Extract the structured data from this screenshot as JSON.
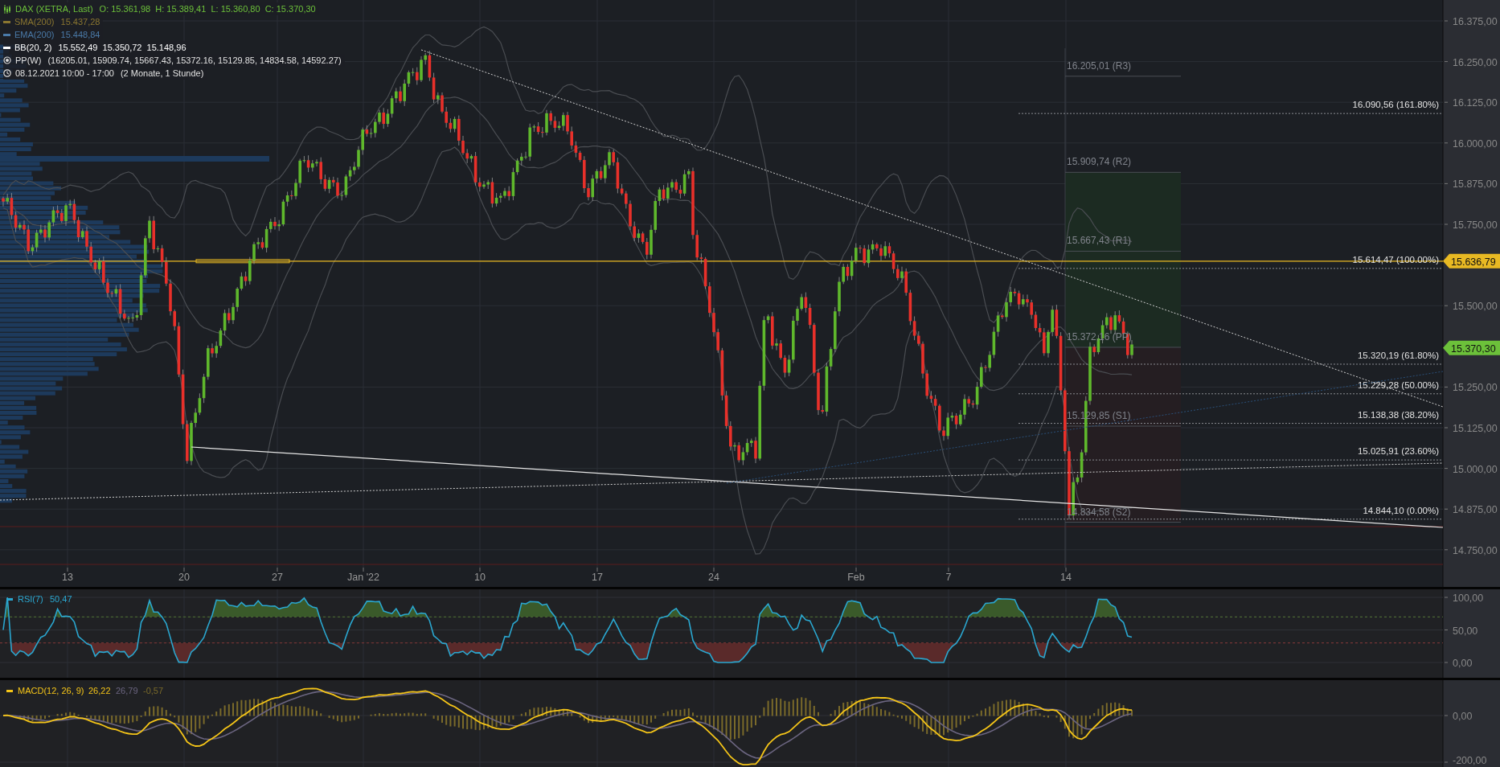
{
  "legend": [
    {
      "kind": "price",
      "label": "DAX (XETRA, Last)",
      "values": "O: 15.361,98  H: 15.389,41  L: 15.360,80  C: 15.370,30",
      "color": "#6cc13a"
    },
    {
      "kind": "line",
      "label": "SMA(200)",
      "values": "15.437,28",
      "color": "#8a7630"
    },
    {
      "kind": "line",
      "label": "EMA(200)",
      "values": "15.448,84",
      "color": "#4a7aa8"
    },
    {
      "kind": "line",
      "label": "BB(20, 2)",
      "values": "15.552,49  15.350,72  15.148,96",
      "color": "#ffffff"
    },
    {
      "kind": "pivot",
      "label": "PP(W)",
      "values": "(16205.01, 15909.74, 15667.43, 15372.16, 15129.85, 14834.58, 14592.27)",
      "color": "#e0e0e0"
    },
    {
      "kind": "time",
      "label": "08.12.2021 10:00 - 17:00",
      "values": "(2 Monate, 1 Stunde)",
      "color": "#e0e0e0"
    }
  ],
  "price_axis": {
    "ticks": [
      "16.375,00",
      "16.250,00",
      "16.125,00",
      "16.000,00",
      "15.875,00",
      "15.750,00",
      "15.500,00",
      "15.250,00",
      "15.125,00",
      "15.000,00",
      "14.875,00",
      "14.750,00"
    ]
  },
  "price_tags": [
    {
      "text": "15.636,79",
      "color": "#e8b923"
    },
    {
      "text": "15.370,30",
      "color": "#6cc13a"
    }
  ],
  "fib_levels": [
    "16.090,56 (161.80%)",
    "15.614,47 (100.00%)",
    "15.320,19 (61.80%)",
    "15.229,28 (50.00%)",
    "15.138,38 (38.20%)",
    "15.025,91 (23.60%)",
    "14.844,10 (0.00%)"
  ],
  "pivots": [
    "16.205,01 (R3)",
    "15.909,74 (R2)",
    "15.667,43 (R1)",
    "15.372,16 (PP)",
    "15.129,85 (S1)",
    "14.834,58 (S2)"
  ],
  "time_axis": {
    "labels": [
      "13",
      "20",
      "27",
      "Jan '22",
      "10",
      "17",
      "24",
      "Feb",
      "7",
      "14"
    ]
  },
  "rsi": {
    "label": "RSI(7)",
    "value": "50,47",
    "color": "#2aa7d0",
    "ticks": [
      "100,00",
      "50,00",
      "0,00"
    ]
  },
  "macd": {
    "label": "MACD(12, 26, 9)",
    "values": [
      {
        "text": "26,22",
        "color": "#f5c518"
      },
      {
        "text": "26,79",
        "color": "#6b6580"
      },
      {
        "text": "-0,57",
        "color": "#7a6a2a"
      }
    ],
    "ticks": [
      "0,00",
      "-200,00"
    ]
  }
}
